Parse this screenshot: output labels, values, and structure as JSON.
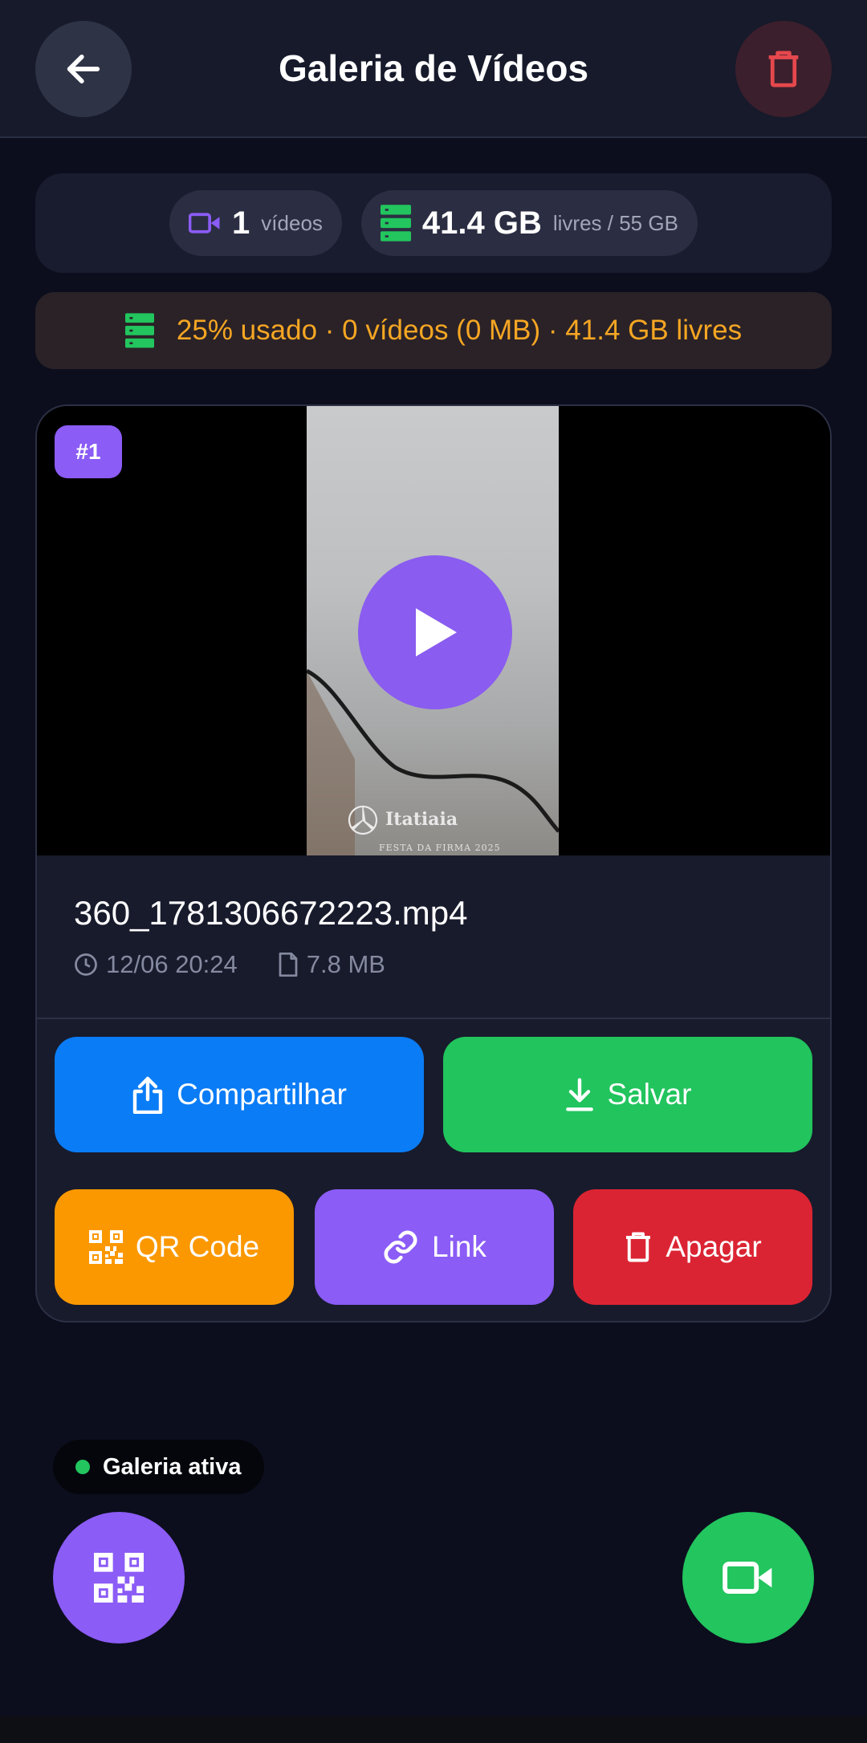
{
  "header": {
    "title": "Galeria de Vídeos",
    "back_icon": "arrow-left-icon",
    "delete_all_icon": "trash-icon"
  },
  "stats": {
    "videos_count": "1",
    "videos_label": "vídeos",
    "free_value": "41.4 GB",
    "free_label": "livres / 55 GB"
  },
  "usage": {
    "text": "25% usado · 0 vídeos (0 MB) · 41.4 GB livres"
  },
  "video": {
    "index_badge": "#1",
    "file_name": "360_1781306672223.mp4",
    "date": "12/06 20:24",
    "size": "7.8 MB",
    "watermark_name": "Itatiaia",
    "watermark_sub": "FESTA DA FIRMA 2025"
  },
  "actions": {
    "share": "Compartilhar",
    "save": "Salvar",
    "qr": "QR Code",
    "link": "Link",
    "delete": "Apagar"
  },
  "status": {
    "label": "Galeria ativa"
  },
  "colors": {
    "background": "#0c0e1d",
    "accent_purple": "#8b5cf6",
    "share_blue": "#0a7cf6",
    "save_green": "#21c45d",
    "qr_orange": "#fb9800",
    "delete_red": "#db2433",
    "usage_text": "#f6a623"
  }
}
